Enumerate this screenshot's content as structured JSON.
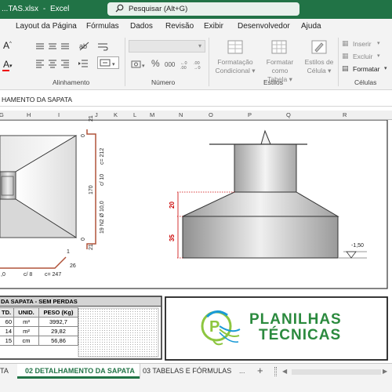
{
  "titlebar": {
    "filename": "...TAS.xlsx",
    "sep": "-",
    "app": "Excel",
    "search_placeholder": "Pesquisar (Alt+G)"
  },
  "menu": [
    "Layout da Página",
    "Fórmulas",
    "Dados",
    "Revisão",
    "Exibir",
    "Desenvolvedor",
    "Ajuda"
  ],
  "ribbon": {
    "groups": {
      "alignment": "Alinhamento",
      "number": "Número",
      "styles": "Estilos",
      "cells": "Células"
    },
    "number_symbols": {
      "percent": "%",
      "thousands": "000"
    },
    "styles": {
      "conditional": [
        "Formatação",
        "Condicional ▾"
      ],
      "table": [
        "Formatar como",
        "Tabela ▾"
      ],
      "cell": [
        "Estilos de",
        "Célula ▾"
      ]
    },
    "cells": {
      "insert": "Inserir",
      "delete": "Excluir",
      "format": "Formatar"
    }
  },
  "formula_bar": {
    "content": "HAMENTO DA SAPATA"
  },
  "columns": [
    "G",
    "H",
    "I",
    "J",
    "K",
    "L",
    "M",
    "N",
    "O",
    "P",
    "Q",
    "R"
  ],
  "drawing": {
    "rebar": {
      "top_hook": "21",
      "top_zero": "0",
      "c_212": "c= 212",
      "c10": "c/ 10",
      "n2": "19 N2 Ø 10,0",
      "len170": "170",
      "bottom_zero": "0",
      "bottom_hook": "21",
      "h1": "1",
      "h26": "26",
      "bottom_label_a": ",0",
      "bottom_label_b": "c/ 8",
      "bottom_label_c": "c= 247"
    },
    "section": {
      "dim_20": "20",
      "dim_35": "35",
      "level": "-1,50"
    }
  },
  "table": {
    "title": "DA SAPATA - SEM PERDAS",
    "headers": [
      "TD.",
      "UNID.",
      "PESO (Kg)"
    ],
    "rows": [
      [
        "60",
        "m³",
        "3992,7"
      ],
      [
        "14",
        "m²",
        "29,82"
      ],
      [
        "15",
        "cm",
        "56,86"
      ]
    ]
  },
  "logo": {
    "line1": "PLANILHAS",
    "line2": "TÉCNICAS"
  },
  "sheet_tabs": {
    "tab1": "TA",
    "tab2": "02 DETALHAMENTO DA SAPATA",
    "tab3": "03 TABELAS E FÓRMULAS",
    "more": "...",
    "add": "+"
  }
}
